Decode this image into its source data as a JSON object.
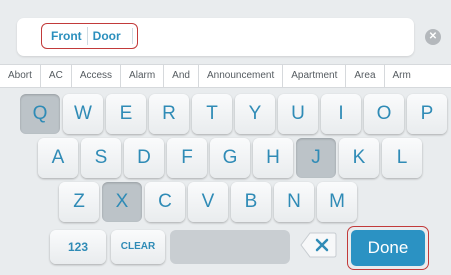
{
  "input": {
    "tokens": [
      "Front",
      "Door"
    ],
    "clear_icon": "close-icon"
  },
  "suggestions": [
    "Abort",
    "AC",
    "Access",
    "Alarm",
    "And",
    "Announcement",
    "Apartment",
    "Area",
    "Arm"
  ],
  "keyboard": {
    "row1": [
      "Q",
      "W",
      "E",
      "R",
      "T",
      "Y",
      "U",
      "I",
      "O",
      "P"
    ],
    "row2": [
      "A",
      "S",
      "D",
      "F",
      "G",
      "H",
      "J",
      "K",
      "L"
    ],
    "row3": [
      "Z",
      "X",
      "C",
      "V",
      "B",
      "N",
      "M"
    ],
    "pressed_keys": [
      "Q",
      "J",
      "X"
    ],
    "numbers_label": "123",
    "clear_label": "CLEAR",
    "backspace_icon": "backspace-icon",
    "done_label": "Done"
  },
  "colors": {
    "accent": "#2b92c3",
    "highlight_outline": "#c23a3a",
    "background": "#e9ecee"
  }
}
